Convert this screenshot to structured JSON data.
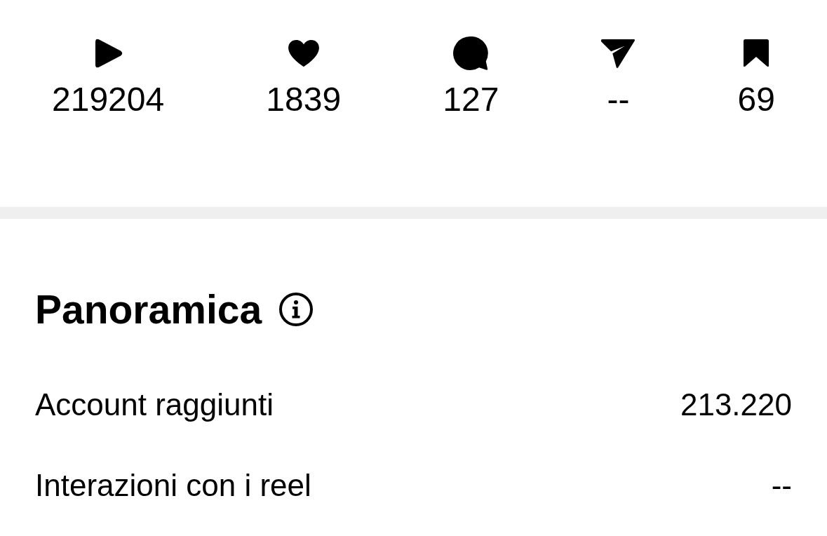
{
  "stats": [
    {
      "kind": "plays",
      "value": "219204"
    },
    {
      "kind": "likes",
      "value": "1839"
    },
    {
      "kind": "comments",
      "value": "127"
    },
    {
      "kind": "shares",
      "value": "--"
    },
    {
      "kind": "saves",
      "value": "69"
    }
  ],
  "overview": {
    "title": "Panoramica",
    "rows": [
      {
        "label": "Account raggiunti",
        "value": "213.220"
      },
      {
        "label": "Interazioni con i reel",
        "value": "--"
      }
    ]
  }
}
